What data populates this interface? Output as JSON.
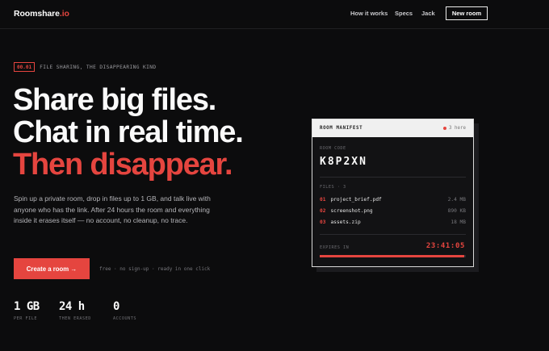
{
  "nav": {
    "brand_main": "Roomshare",
    "brand_accent": ".io",
    "links": [
      "How it works",
      "Specs",
      "Jack"
    ],
    "new_room": "New room"
  },
  "hero": {
    "tag_code": "00.01",
    "tag_text": "FILE SHARING, THE DISAPPEARING KIND",
    "headline": [
      "Share big files.",
      "Chat in real time.",
      "Then disappear."
    ],
    "lede": "Spin up a private room, drop in files up to 1 GB, and talk live with anyone who has the link. After 24 hours the room and everything inside it erases itself — no account, no cleanup, no trace.",
    "cta": "Create a room →",
    "cta_note": "free · no sign-up · ready in one click"
  },
  "stats": [
    {
      "value": "1 GB",
      "label": "PER FILE"
    },
    {
      "value": "24 h",
      "label": "THEN ERASED"
    },
    {
      "value": "0",
      "label": "ACCOUNTS"
    }
  ],
  "manifest": {
    "title": "ROOM MANIFEST",
    "here": "3 here",
    "room_code_label": "ROOM CODE",
    "room_code": "K8P2XN",
    "files_label": "FILES · 3",
    "files": [
      {
        "num": "01",
        "name": "project_brief.pdf",
        "size": "2.4 MB"
      },
      {
        "num": "02",
        "name": "screenshot.png",
        "size": "890 KB"
      },
      {
        "num": "03",
        "name": "assets.zip",
        "size": "18 MB"
      }
    ],
    "expires_label": "EXPIRES IN",
    "timer": "23:41:05",
    "remaining_fraction": 0.99
  },
  "colors": {
    "accent": "#e5453f",
    "background": "#0c0c0d"
  }
}
